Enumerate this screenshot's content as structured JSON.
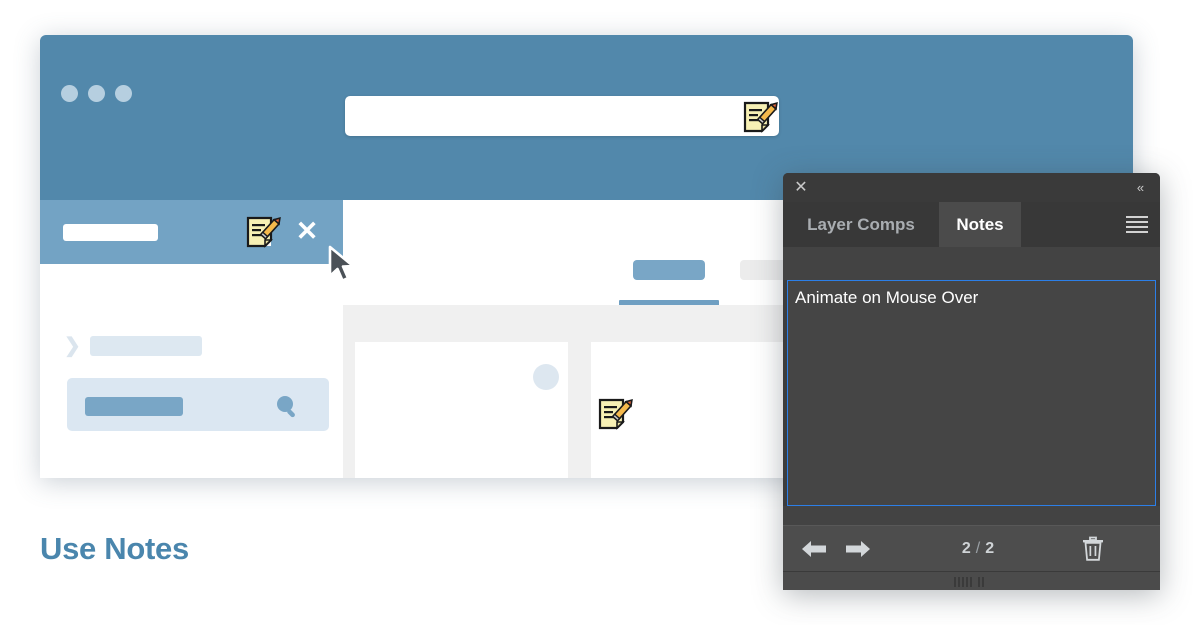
{
  "caption": {
    "text": "Use Notes",
    "color": "#4a86ad"
  },
  "app_window": {
    "traffic_lights": [
      "window-dot-close",
      "window-dot-minimize",
      "window-dot-zoom"
    ],
    "titlebar_color": "#5288ab",
    "search": {
      "value": "",
      "placeholder": ""
    },
    "search_note_icon": "note-pencil-icon",
    "sub_bar": {
      "title_placeholder": "",
      "note_icon": "note-pencil-icon",
      "close_label": "✕"
    },
    "sidebar": {
      "rows": [
        {
          "icon": "chevron-right-icon",
          "label": ""
        },
        {
          "icon": "chevron-right-icon",
          "label": ""
        }
      ],
      "selected_row": {
        "label": "",
        "icon": "search-magnifier-icon"
      }
    },
    "content": {
      "tabs": [
        {
          "label": "",
          "active": true
        },
        {
          "label": "",
          "active": false
        }
      ],
      "cards": [
        "",
        "",
        ""
      ],
      "canvas_note_icon": "note-pencil-icon"
    }
  },
  "notes_panel": {
    "titlebar": {
      "close_label": "✕",
      "collapse_label": "«"
    },
    "tabs": [
      {
        "label": "Layer Comps",
        "active": false
      },
      {
        "label": "Notes",
        "active": true
      }
    ],
    "menu_icon": "hamburger-menu-icon",
    "note": {
      "text": "Animate on Mouse Over",
      "placeholder": ""
    },
    "footer": {
      "prev_icon": "arrow-left-icon",
      "next_icon": "arrow-right-icon",
      "current_page": "2",
      "separator": "/",
      "total_pages": "2",
      "delete_icon": "trash-icon"
    },
    "colors": {
      "panel_bg": "#3d3d3d",
      "active_tab_bg": "#4b4b4b",
      "textarea_bg": "#454545",
      "focus_border": "#2c7fe8",
      "footer_bg": "#4d4d4d"
    }
  },
  "cursor": {
    "icon": "mouse-arrow-cursor"
  }
}
